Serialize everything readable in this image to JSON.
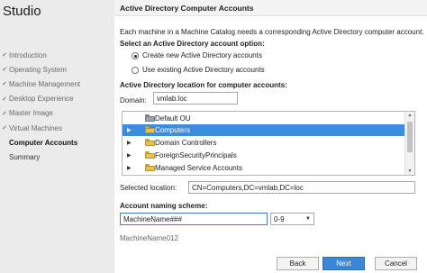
{
  "sidebar": {
    "title": "Studio",
    "steps": [
      {
        "label": "Introduction",
        "done": true
      },
      {
        "label": "Operating System",
        "done": true
      },
      {
        "label": "Machine Management",
        "done": true
      },
      {
        "label": "Desktop Experience",
        "done": true
      },
      {
        "label": "Master Image",
        "done": true
      },
      {
        "label": "Virtual Machines",
        "done": true
      },
      {
        "label": "Computer Accounts",
        "done": false,
        "active": true
      },
      {
        "label": "Summary",
        "done": false
      }
    ]
  },
  "main": {
    "title": "Active Directory Computer Accounts",
    "description": "Each machine in a Machine Catalog needs a corresponding Active Directory computer account.",
    "select_option_label": "Select an Active Directory account option:",
    "options": [
      {
        "label": "Create new Active Directory accounts",
        "selected": true
      },
      {
        "label": "Use existing Active Directory accounts",
        "selected": false
      }
    ],
    "location_label": "Active Directory location for computer accounts:",
    "domain_label": "Domain:",
    "domain_value": "vmlab.loc",
    "tree": [
      {
        "label": "Default OU",
        "expandable": false,
        "selected": false,
        "icon": "gear-folder-icon"
      },
      {
        "label": "Computers",
        "expandable": true,
        "selected": true,
        "icon": "folder-icon"
      },
      {
        "label": "Domain Controllers",
        "expandable": true,
        "selected": false,
        "icon": "folder-icon"
      },
      {
        "label": "ForeignSecurityPrincipals",
        "expandable": true,
        "selected": false,
        "icon": "folder-icon"
      },
      {
        "label": "Managed Service Accounts",
        "expandable": true,
        "selected": false,
        "icon": "folder-icon"
      }
    ],
    "selected_location_label": "Selected location:",
    "selected_location_value": "CN=Computers,DC=vmlab,DC=loc",
    "naming_label": "Account naming scheme:",
    "naming_value": "MachineName###",
    "naming_type": "0-9",
    "naming_preview": "MachineName012"
  },
  "buttons": {
    "back": "Back",
    "next": "Next",
    "cancel": "Cancel"
  },
  "colors": {
    "accent": "#3b86d8",
    "selection": "#3a8ee0"
  }
}
